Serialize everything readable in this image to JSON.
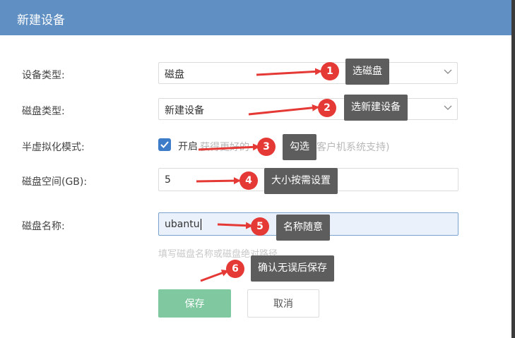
{
  "header": {
    "title": "新建设备"
  },
  "form": {
    "device_type": {
      "label": "设备类型:",
      "value": "磁盘"
    },
    "disk_type": {
      "label": "磁盘类型:",
      "value": "新建设备"
    },
    "semi_virtual": {
      "label": "半虚拟化模式:",
      "checked": true,
      "option_label": "开启",
      "hint_left": "获得更好的",
      "hint_right": "客户机系统支持)"
    },
    "disk_space": {
      "label": "磁盘空间(GB):",
      "value": "5"
    },
    "disk_name": {
      "label": "磁盘名称:",
      "value": "ubantu",
      "helper": "填写磁盘名称或磁盘绝对路径"
    }
  },
  "buttons": {
    "save": "保存",
    "cancel": "取消"
  },
  "annotations": [
    {
      "number": "1",
      "text": "选磁盘"
    },
    {
      "number": "2",
      "text": "选新建设备"
    },
    {
      "number": "3",
      "text": "勾选"
    },
    {
      "number": "4",
      "text": "大小按需设置"
    },
    {
      "number": "5",
      "text": "名称随意"
    },
    {
      "number": "6",
      "text": "确认无误后保存"
    }
  ],
  "colors": {
    "header": "#5f8fc3",
    "checkbox": "#3d7cc9",
    "save_button": "#7fc8a0",
    "annotation_badge": "#e53935",
    "annotation_callout": "#5d5d5d"
  }
}
